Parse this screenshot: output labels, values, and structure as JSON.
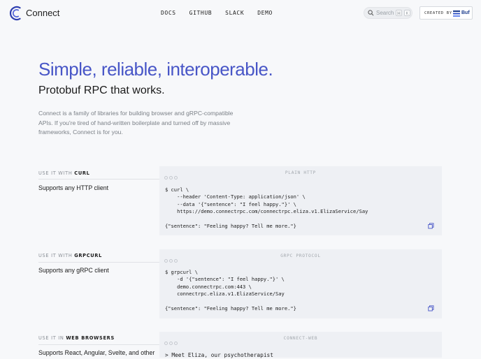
{
  "header": {
    "brand": "Connect",
    "nav": [
      "DOCS",
      "GITHUB",
      "SLACK",
      "DEMO"
    ],
    "search_placeholder": "Search",
    "search_keys": [
      "⌘",
      "K"
    ],
    "created_by": "CREATED BY",
    "company": "Buf"
  },
  "hero": {
    "title": "Simple, reliable, interoperable.",
    "subtitle": "Protobuf RPC that works.",
    "description": "Connect is a family of libraries for building browser and gRPC-compatible APIs. If you're tired of hand-written boilerplate and turned off by massive frameworks, Connect is for you."
  },
  "sections": [
    {
      "label_prefix": "USE IT WITH",
      "label_tool": "CURL",
      "heading": "Supports any HTTP client",
      "panel_title": "PLAIN HTTP",
      "code": "$ curl \\\n    --header 'Content-Type: application/json' \\\n    --data '{\"sentence\": \"I feel happy.\"}' \\\n    https://demo.connectrpc.com/connectrpc.eliza.v1.ElizaService/Say\n\n{\"sentence\": \"Feeling happy? Tell me more.\"}"
    },
    {
      "label_prefix": "USE IT WITH",
      "label_tool": "GRPCURL",
      "heading": "Supports any gRPC client",
      "panel_title": "GRPC PROTOCOL",
      "code": "$ grpcurl \\\n    -d '{\"sentence\": \"I feel happy.\"}' \\\n    demo.connectrpc.com:443 \\\n    connectrpc.eliza.v1.ElizaService/Say\n\n{\"sentence\": \"Feeling happy? Tell me more.\"}"
    },
    {
      "label_prefix": "USE IT IN",
      "label_tool": "WEB BROWSERS",
      "heading": "Supports React, Angular, Svelte, and other",
      "panel_title": "CONNECT-WEB",
      "code": "> Meet Eliza, our psychotherapist"
    }
  ],
  "colors": {
    "accent": "#4856c7",
    "panel_bg": "#eef0f4",
    "page_bg": "#f7f8fa",
    "muted_text": "#7b8087"
  }
}
